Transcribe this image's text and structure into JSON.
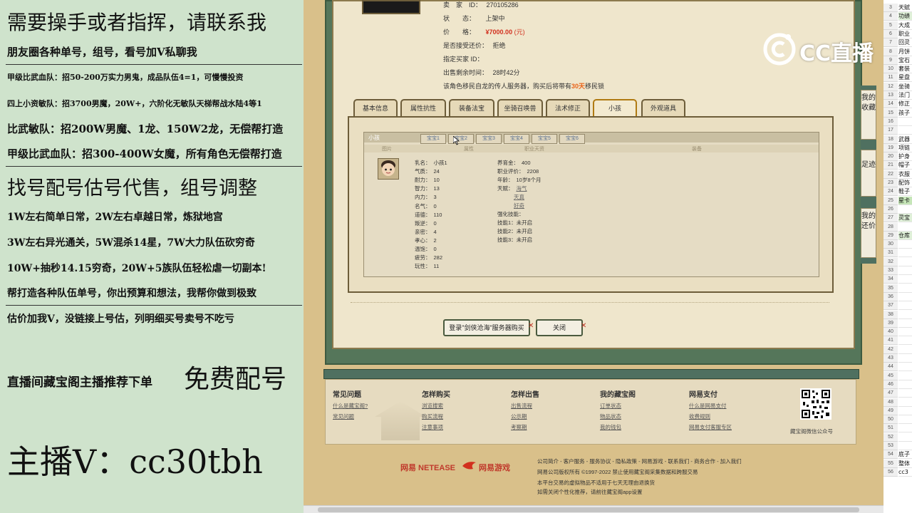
{
  "left_panel": {
    "lines": [
      "需要操手或者指挥，请联系我",
      "朋友圈各种单号，组号，看号加V私聊我",
      "甲级比武血队：招50-200万实力男鬼，成品队伍4=1，可慢慢投资",
      "四上小资敏队：招3700男魔，20W+，六阶化无敏队天梯帮战水陆4等1",
      "比武敏队：招200W男魔、1龙、150W2龙，无偿帮打造",
      "甲级比武血队：招300-400W女魔，所有角色无偿帮打造",
      "找号配号估号代售，组号调整",
      "1W左右简单日常，2W左右卓越日常，炼狱地宫",
      "3W左右异光通关，5W混杀14星，7W大力队伍砍穷奇",
      "10W+抽秒14.15穷奇，20W+5族队伍轻松虐一切副本!",
      "帮打造各种队伍单号，你出预算和想法，我帮你做到极致",
      "估价加我V，没链接上号估，列明细买号卖号不吃亏",
      "直播间藏宝阁主播推荐下单",
      "免费配号",
      "主播V：cc30tbh"
    ]
  },
  "logo": {
    "text": "CC直播"
  },
  "seller_info": {
    "seller_label": "卖　家　ID：",
    "seller_id": "270105286",
    "status_label": "状　　态：",
    "status_value": "上架中",
    "price_label": "价　　格：",
    "price_value": "¥7000.00",
    "price_unit": "(元)",
    "bargain_label": "是否接受还价：",
    "bargain_value": "拒绝",
    "buyer_label": "指定买家 ID：",
    "remain_label": "出售剩余时间：",
    "remain_value": "28时42分",
    "notice_prefix": "该角色移民自龙的传人服务器，购买后将带有",
    "notice_highlight": "30天",
    "notice_suffix": "移民锁"
  },
  "tabs": [
    "基本信息",
    "属性抗性",
    "装备法宝",
    "坐骑召唤兽",
    "法术修正",
    "小孩",
    "外观道具"
  ],
  "pet_panel": {
    "title": "小孩",
    "sub_tabs": [
      "宝宝1",
      "宝宝2",
      "宝宝3",
      "宝宝4",
      "宝宝5",
      "宝宝6"
    ],
    "headers": [
      "图片",
      "属性",
      "职业天资",
      "装备"
    ],
    "stats_left": [
      {
        "label": "乳名：",
        "value": "小孩1"
      },
      {
        "label": "气质：",
        "value": "24"
      },
      {
        "label": "耐力：",
        "value": "10"
      },
      {
        "label": "智力：",
        "value": "13"
      },
      {
        "label": "内力：",
        "value": "3"
      },
      {
        "label": "名气：",
        "value": "0"
      },
      {
        "label": "道德：",
        "value": "110"
      },
      {
        "label": "叛逆：",
        "value": "0"
      },
      {
        "label": "亲密：",
        "value": "4"
      },
      {
        "label": "孝心：",
        "value": "2"
      },
      {
        "label": "温饱：",
        "value": "0"
      },
      {
        "label": "疲劳：",
        "value": "282"
      },
      {
        "label": "玩性：",
        "value": "11"
      }
    ],
    "stats_right": [
      {
        "label": "养育金：",
        "value": "400"
      },
      {
        "label": "职业评价：",
        "value": "2208"
      },
      {
        "label": "年龄：",
        "value": "10岁8个月"
      },
      {
        "label": "天赋：",
        "value": "海气"
      }
    ],
    "talent_extra": [
      "天真",
      "好奇"
    ],
    "skills": [
      {
        "label": "强化技能：",
        "value": ""
      },
      {
        "label": "技能1：",
        "value": "未开启"
      },
      {
        "label": "技能2：",
        "value": "未开启"
      },
      {
        "label": "技能3：",
        "value": "未开启"
      }
    ]
  },
  "buttons": {
    "login_buy": "登录\"剑侠沧海\"服务器购买",
    "close": "关闭"
  },
  "footer": {
    "columns": [
      {
        "title": "常见问题",
        "links": [
          "什么是藏宝阁?",
          "常见问题"
        ]
      },
      {
        "title": "怎样购买",
        "links": [
          "浏览搜索",
          "购买流程",
          "注意事项"
        ]
      },
      {
        "title": "怎样出售",
        "links": [
          "出售流程",
          "公示期",
          "考察期"
        ]
      },
      {
        "title": "我的藏宝阁",
        "links": [
          "订单状态",
          "物品状态",
          "我的钱包"
        ]
      },
      {
        "title": "网易支付",
        "links": [
          "什么是网易支付",
          "收费规则",
          "网易支付客服专区"
        ]
      }
    ],
    "qr_caption": "藏宝阁微信公众号",
    "brand_netease": "网易 NETEASE",
    "brand_games": "网易游戏",
    "copyright_lines": [
      "公司简介 - 客户服务 - 服务协议 - 隐私政策 - 网易游戏 - 联系我们 - 商务合作 - 加入我们",
      "网易公司版权所有 ©1997-2022  禁止使用藏宝阁采集数据和跨服交易",
      "本平台交易的虚拟物品不适用于七天无理由退换货",
      "如需关闭个性化推荐，请前往藏宝阁app设置"
    ]
  },
  "sidebar": {
    "items": [
      "我的收藏",
      "足迹",
      "我的还价"
    ]
  },
  "spreadsheet": {
    "rows": [
      {
        "num": "3",
        "text": "天赋"
      },
      {
        "num": "4",
        "text": "功绩"
      },
      {
        "num": "5",
        "text": "大成"
      },
      {
        "num": "6",
        "text": "职业"
      },
      {
        "num": "7",
        "text": "回灵"
      },
      {
        "num": "8",
        "text": "月饼"
      },
      {
        "num": "9",
        "text": "宝石"
      },
      {
        "num": "10",
        "text": "套装"
      },
      {
        "num": "11",
        "text": "星盘"
      },
      {
        "num": "12",
        "text": "坐骑"
      },
      {
        "num": "13",
        "text": "法门"
      },
      {
        "num": "14",
        "text": "修正"
      },
      {
        "num": "15",
        "text": "孩子"
      },
      {
        "num": "16",
        "text": ""
      },
      {
        "num": "17",
        "text": ""
      },
      {
        "num": "18",
        "text": "武器"
      },
      {
        "num": "19",
        "text": "项链"
      },
      {
        "num": "20",
        "text": "护身"
      },
      {
        "num": "21",
        "text": "帽子"
      },
      {
        "num": "22",
        "text": "衣服"
      },
      {
        "num": "23",
        "text": "配饰"
      },
      {
        "num": "24",
        "text": "鞋子"
      },
      {
        "num": "25",
        "text": "星卡"
      },
      {
        "num": "26",
        "text": ""
      },
      {
        "num": "27",
        "text": "灵宝"
      },
      {
        "num": "28",
        "text": ""
      },
      {
        "num": "29",
        "text": "仓库"
      },
      {
        "num": "30",
        "text": ""
      },
      {
        "num": "31",
        "text": ""
      },
      {
        "num": "32",
        "text": ""
      },
      {
        "num": "33",
        "text": ""
      },
      {
        "num": "34",
        "text": ""
      },
      {
        "num": "35",
        "text": ""
      },
      {
        "num": "36",
        "text": ""
      },
      {
        "num": "37",
        "text": ""
      },
      {
        "num": "38",
        "text": ""
      },
      {
        "num": "39",
        "text": ""
      },
      {
        "num": "40",
        "text": ""
      },
      {
        "num": "41",
        "text": ""
      },
      {
        "num": "42",
        "text": ""
      },
      {
        "num": "43",
        "text": ""
      },
      {
        "num": "44",
        "text": ""
      },
      {
        "num": "45",
        "text": ""
      },
      {
        "num": "46",
        "text": ""
      },
      {
        "num": "47",
        "text": ""
      },
      {
        "num": "48",
        "text": ""
      },
      {
        "num": "49",
        "text": ""
      },
      {
        "num": "50",
        "text": ""
      },
      {
        "num": "51",
        "text": ""
      },
      {
        "num": "52",
        "text": ""
      },
      {
        "num": "53",
        "text": ""
      },
      {
        "num": "54",
        "text": "底子"
      },
      {
        "num": "55",
        "text": "整体"
      },
      {
        "num": "56",
        "text": "cc3"
      }
    ]
  },
  "colors": {
    "price_red": "#d2301e",
    "highlight_orange": "#e8641a",
    "panel_green": "#55765a",
    "left_bg": "#cfe3cc"
  }
}
